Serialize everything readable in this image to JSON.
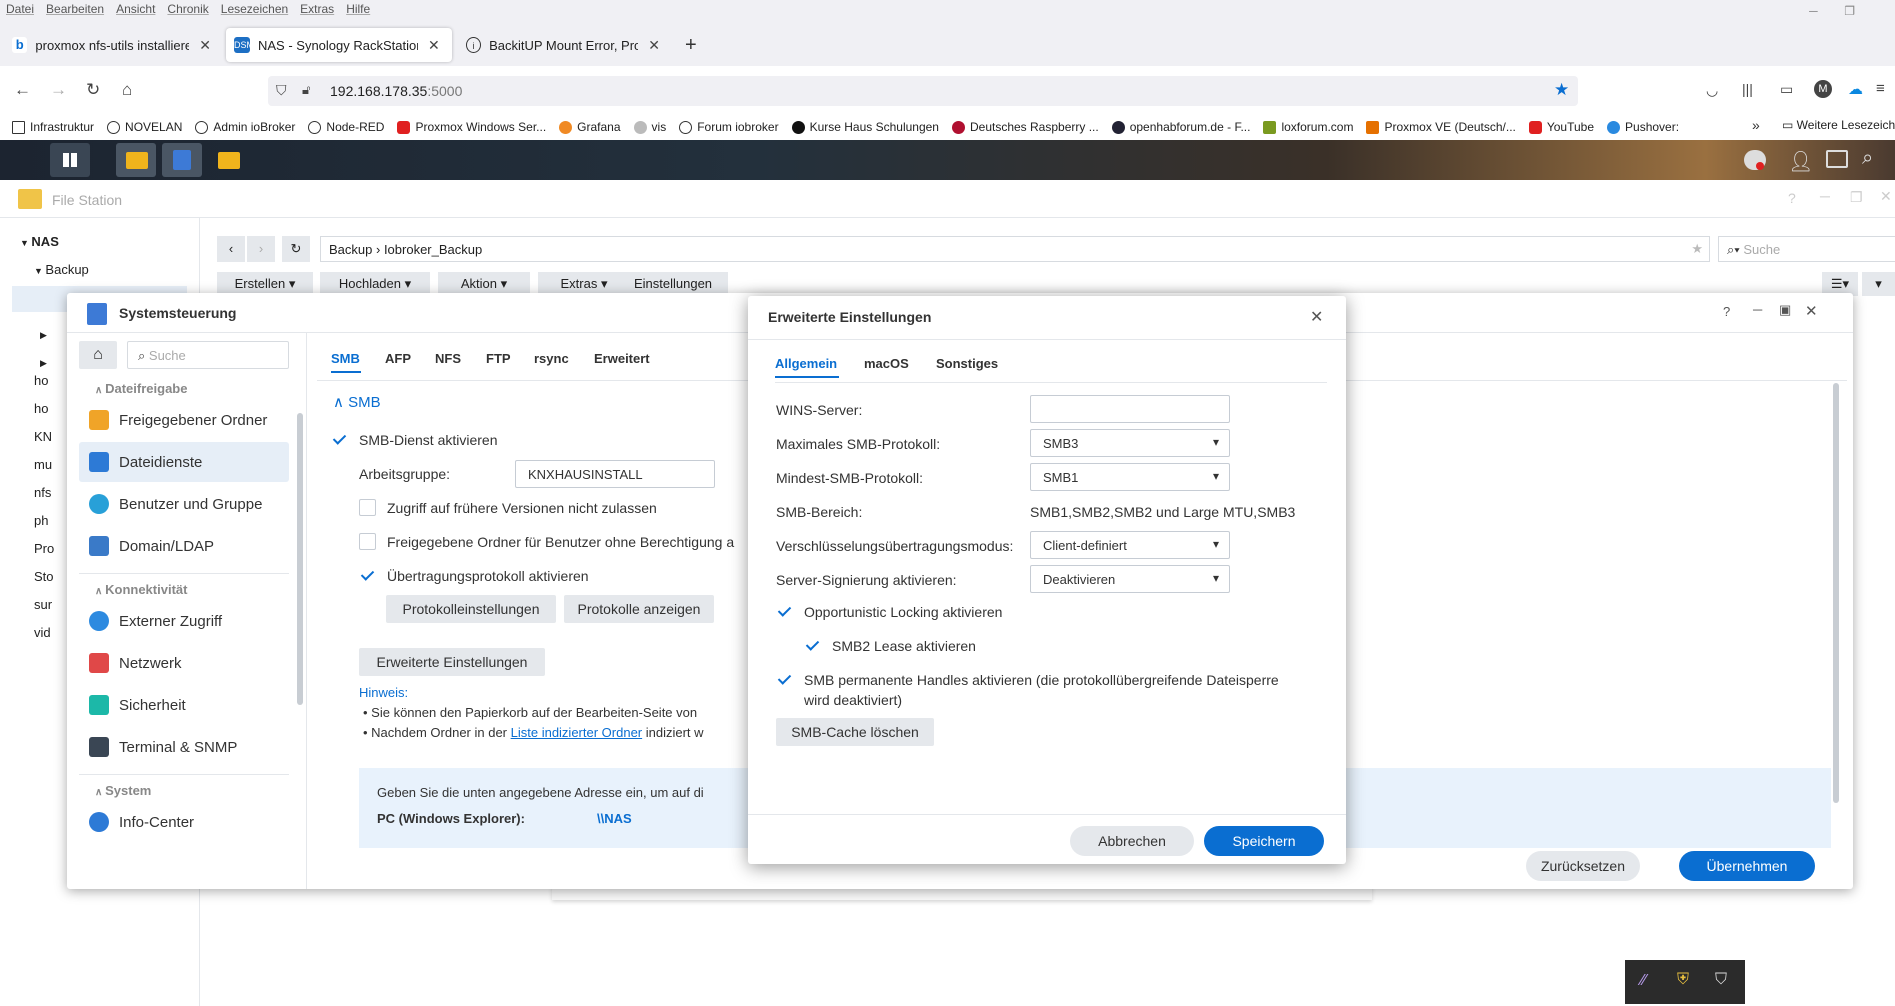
{
  "menubar": [
    "Datei",
    "Bearbeiten",
    "Ansicht",
    "Chronik",
    "Lesezeichen",
    "Extras",
    "Hilfe"
  ],
  "tabs": [
    {
      "label": "proxmox nfs-utils installieren - ",
      "fav": "b"
    },
    {
      "label": "NAS - Synology RackStation",
      "fav": "DSM"
    },
    {
      "label": "BackitUP Mount Error, Proxmox",
      "fav": "i"
    }
  ],
  "url": {
    "host": "192.168.178.35",
    "port": ":5000"
  },
  "bookmarks": [
    "Infrastruktur",
    "NOVELAN",
    "Admin ioBroker",
    "Node-RED",
    "Proxmox Windows Ser...",
    "Grafana",
    "vis",
    "Forum iobroker",
    "Kurse Haus Schulungen",
    "Deutsches Raspberry ...",
    "openhabforum.de - F...",
    "loxforum.com",
    "Proxmox VE (Deutsch/...",
    "YouTube",
    "Pushover:",
    "Weitere Lesezeichen"
  ],
  "filestation": {
    "title": "File Station",
    "tree": [
      "NAS",
      "Backup",
      "ho",
      "ho",
      "KN",
      "mu",
      "nfs",
      "ph",
      "Pro",
      "Sto",
      "sur",
      "vid"
    ],
    "path": [
      "Backup",
      "Iobroker_Backup"
    ],
    "search_placeholder": "Suche",
    "toolbar": [
      "Erstellen",
      "Hochladen",
      "Aktion",
      "Extras",
      "Einstellungen"
    ]
  },
  "controlpanel": {
    "title": "Systemsteuerung",
    "search_placeholder": "Suche",
    "sections": {
      "dateifreigabe": "Dateifreigabe",
      "konnektivitaet": "Konnektivität",
      "system": "System"
    },
    "items": [
      "Freigegebener Ordner",
      "Dateidienste",
      "Benutzer und Gruppe",
      "Domain/LDAP",
      "Externer Zugriff",
      "Netzwerk",
      "Sicherheit",
      "Terminal & SNMP",
      "Info-Center"
    ],
    "tabs": [
      "SMB",
      "AFP",
      "NFS",
      "FTP",
      "rsync",
      "Erweitert"
    ],
    "smb_header": "SMB",
    "smb_enable": "SMB-Dienst aktivieren",
    "workgroup_label": "Arbeitsgruppe:",
    "workgroup_value": "KNXHAUSINSTALL",
    "opt1": "Zugriff auf frühere Versionen nicht zulassen",
    "opt2": "Freigegebene Ordner für Benutzer ohne Berechtigung a",
    "opt3": "Übertragungsprotokoll aktivieren",
    "btn_protokolleinstellungen": "Protokolleinstellungen",
    "btn_protokolle": "Protokolle anzeigen",
    "btn_erweitert": "Erweiterte Einstellungen",
    "hinweis": "Hinweis:",
    "note1": "Sie können den Papierkorb auf der Bearbeiten-Seite von",
    "note2_pre": "Nachdem Ordner in der ",
    "note2_link": "Liste indizierter Ordner",
    "note2_post": " indiziert w",
    "info_text": "Geben Sie die unten angegebene Adresse ein, um auf di",
    "pc_label": "PC (Windows Explorer):",
    "pc_value": "\\\\NAS",
    "btn_reset": "Zurücksetzen",
    "btn_apply": "Übernehmen"
  },
  "dialog": {
    "title": "Erweiterte Einstellungen",
    "tabs": [
      "Allgemein",
      "macOS",
      "Sonstiges"
    ],
    "wins_label": "WINS-Server:",
    "wins_value": "",
    "max_label": "Maximales SMB-Protokoll:",
    "max_value": "SMB3",
    "min_label": "Mindest-SMB-Protokoll:",
    "min_value": "SMB1",
    "range_label": "SMB-Bereich:",
    "range_value": "SMB1,SMB2,SMB2 und Large MTU,SMB3",
    "enc_label": "Verschlüsselungsübertragungsmodus:",
    "enc_value": "Client-definiert",
    "sign_label": "Server-Signierung aktivieren:",
    "sign_value": "Deaktivieren",
    "oplock": "Opportunistic Locking aktivieren",
    "smb2lease": "SMB2 Lease aktivieren",
    "handles_line1": "SMB permanente Handles aktivieren (die protokollübergreifende Dateisperre",
    "handles_line2": "wird deaktiviert)",
    "cache_btn": "SMB-Cache löschen",
    "cancel": "Abbrechen",
    "save": "Speichern"
  },
  "colors": {
    "accent": "#0a6ed1",
    "selected": "#e6eef7"
  }
}
